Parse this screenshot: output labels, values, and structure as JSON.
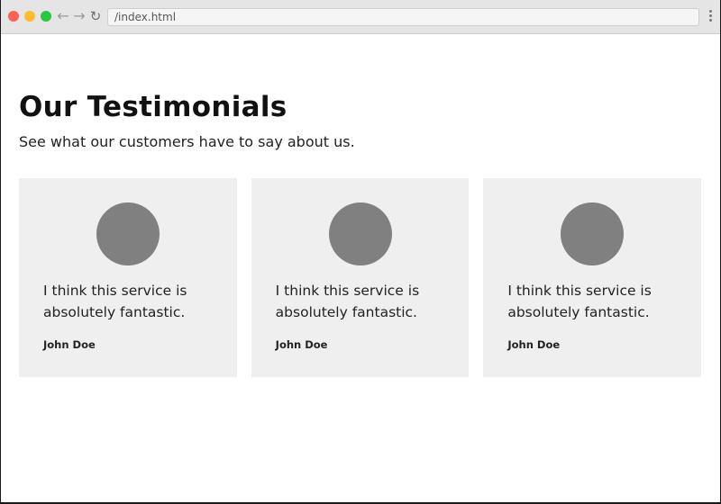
{
  "browser": {
    "url": "/index.html",
    "icons": {
      "back": "arrow-left-icon",
      "forward": "arrow-right-icon",
      "reload": "reload-icon",
      "menu": "kebab-menu-icon"
    }
  },
  "page": {
    "title": "Our Testimonials",
    "subtitle": "See what our customers have to say about us."
  },
  "testimonials": [
    {
      "quote": "I think this service is absolutely fantastic.",
      "author": "John Doe"
    },
    {
      "quote": "I think this service is absolutely fantastic.",
      "author": "John Doe"
    },
    {
      "quote": "I think this service is absolutely fantastic.",
      "author": "John Doe"
    }
  ],
  "colors": {
    "card_background": "#efefef",
    "avatar_placeholder": "#808080",
    "text": "#222222"
  }
}
